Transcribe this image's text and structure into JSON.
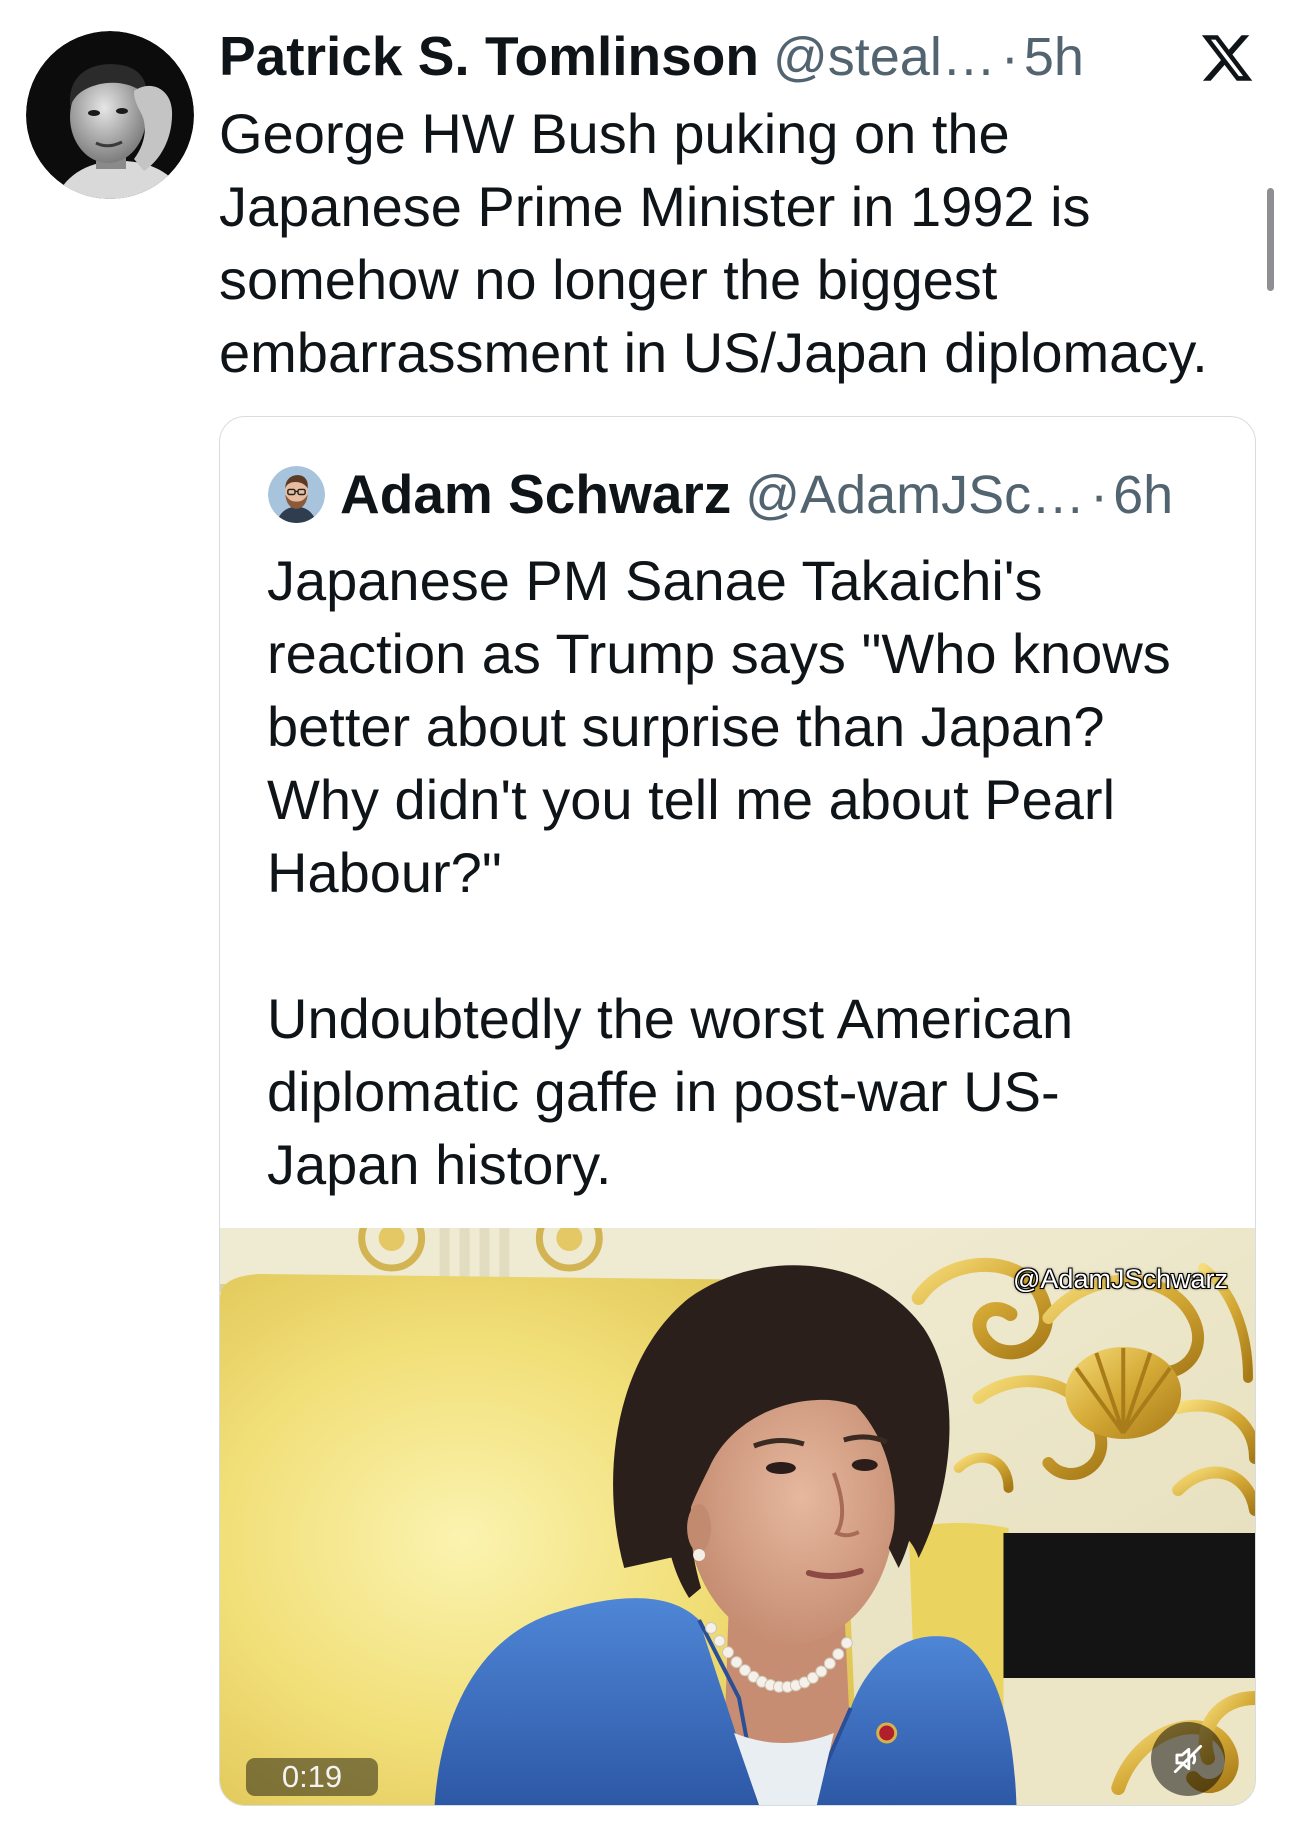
{
  "app": {
    "logo_icon": "x-logo-icon"
  },
  "colors": {
    "text": "#0f1419",
    "secondary_text": "#536471",
    "card_border": "#d6dde2",
    "background": "#ffffff",
    "scrollbar": "#8e8e93"
  },
  "tweet": {
    "author": {
      "name": "Patrick S. Tomlinson",
      "handle": "@steal…",
      "separator": "·",
      "time": "5h",
      "avatar_icon": "profile-photo"
    },
    "text_lines": [
      "George HW Bush puking on the",
      "Japanese Prime Minister in 1992 is",
      "somehow no longer the biggest",
      "embarrassment in US/Japan diplomacy."
    ],
    "quote": {
      "author": {
        "name": "Adam Schwarz",
        "handle": "@AdamJSc…",
        "separator": "·",
        "time": "6h",
        "avatar_icon": "profile-photo"
      },
      "paragraphs": [
        {
          "lines": [
            "Japanese PM Sanae Takaichi's",
            "reaction as Trump says \"Who knows",
            "better about surprise than Japan?",
            "Why didn't you tell me about Pearl",
            "Habour?\""
          ]
        },
        {
          "lines": [
            "Undoubtedly the worst American",
            "diplomatic gaffe in post-war US-",
            "Japan history."
          ]
        }
      ],
      "video": {
        "watermark": "@AdamJSchwarz",
        "duration": "0:19",
        "muted": true,
        "mute_icon": "speaker-muted-icon"
      }
    }
  }
}
